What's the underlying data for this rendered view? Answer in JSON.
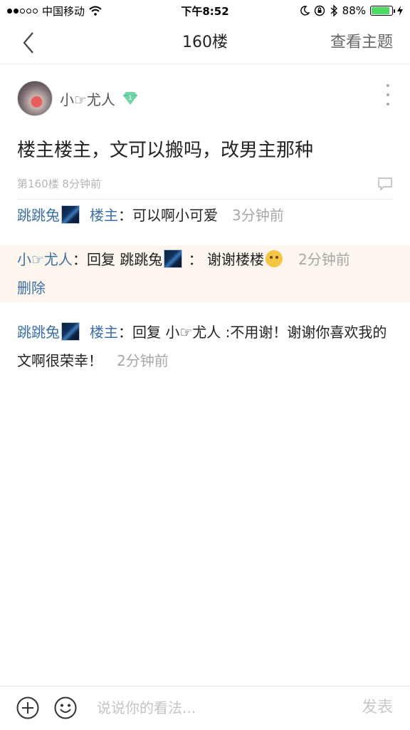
{
  "status_bar": {
    "carrier": "中国移动",
    "time": "下午8:52",
    "battery": "88%",
    "battery_level": 0.88
  },
  "nav": {
    "title": "160楼",
    "action_label": "查看主题"
  },
  "post": {
    "author": "小☞尤人",
    "badge_level": "1",
    "text": "楼主楼主，文可以搬吗，改男主那种",
    "floor": "第160楼",
    "time": "8分钟前"
  },
  "replies": [
    {
      "user": "跳跳兔",
      "floor_tag": "楼主",
      "sep": "：",
      "content": "可以啊小可爱",
      "time": "3分钟前"
    },
    {
      "user": "小☞尤人",
      "sep": "：",
      "reply_prefix": "回复",
      "reply_to": "跳跳兔",
      "sep2": "：",
      "content": "谢谢楼楼",
      "time": "2分钟前",
      "delete_label": "删除"
    },
    {
      "user": "跳跳兔",
      "floor_tag": "楼主",
      "sep": "：",
      "reply_prefix": "回复",
      "reply_to": "小☞尤人",
      "content": ":不用谢！谢谢你喜欢我的文啊很荣幸！",
      "time": "2分钟前"
    }
  ],
  "composer": {
    "placeholder": "说说你的看法...",
    "send_label": "发表"
  }
}
